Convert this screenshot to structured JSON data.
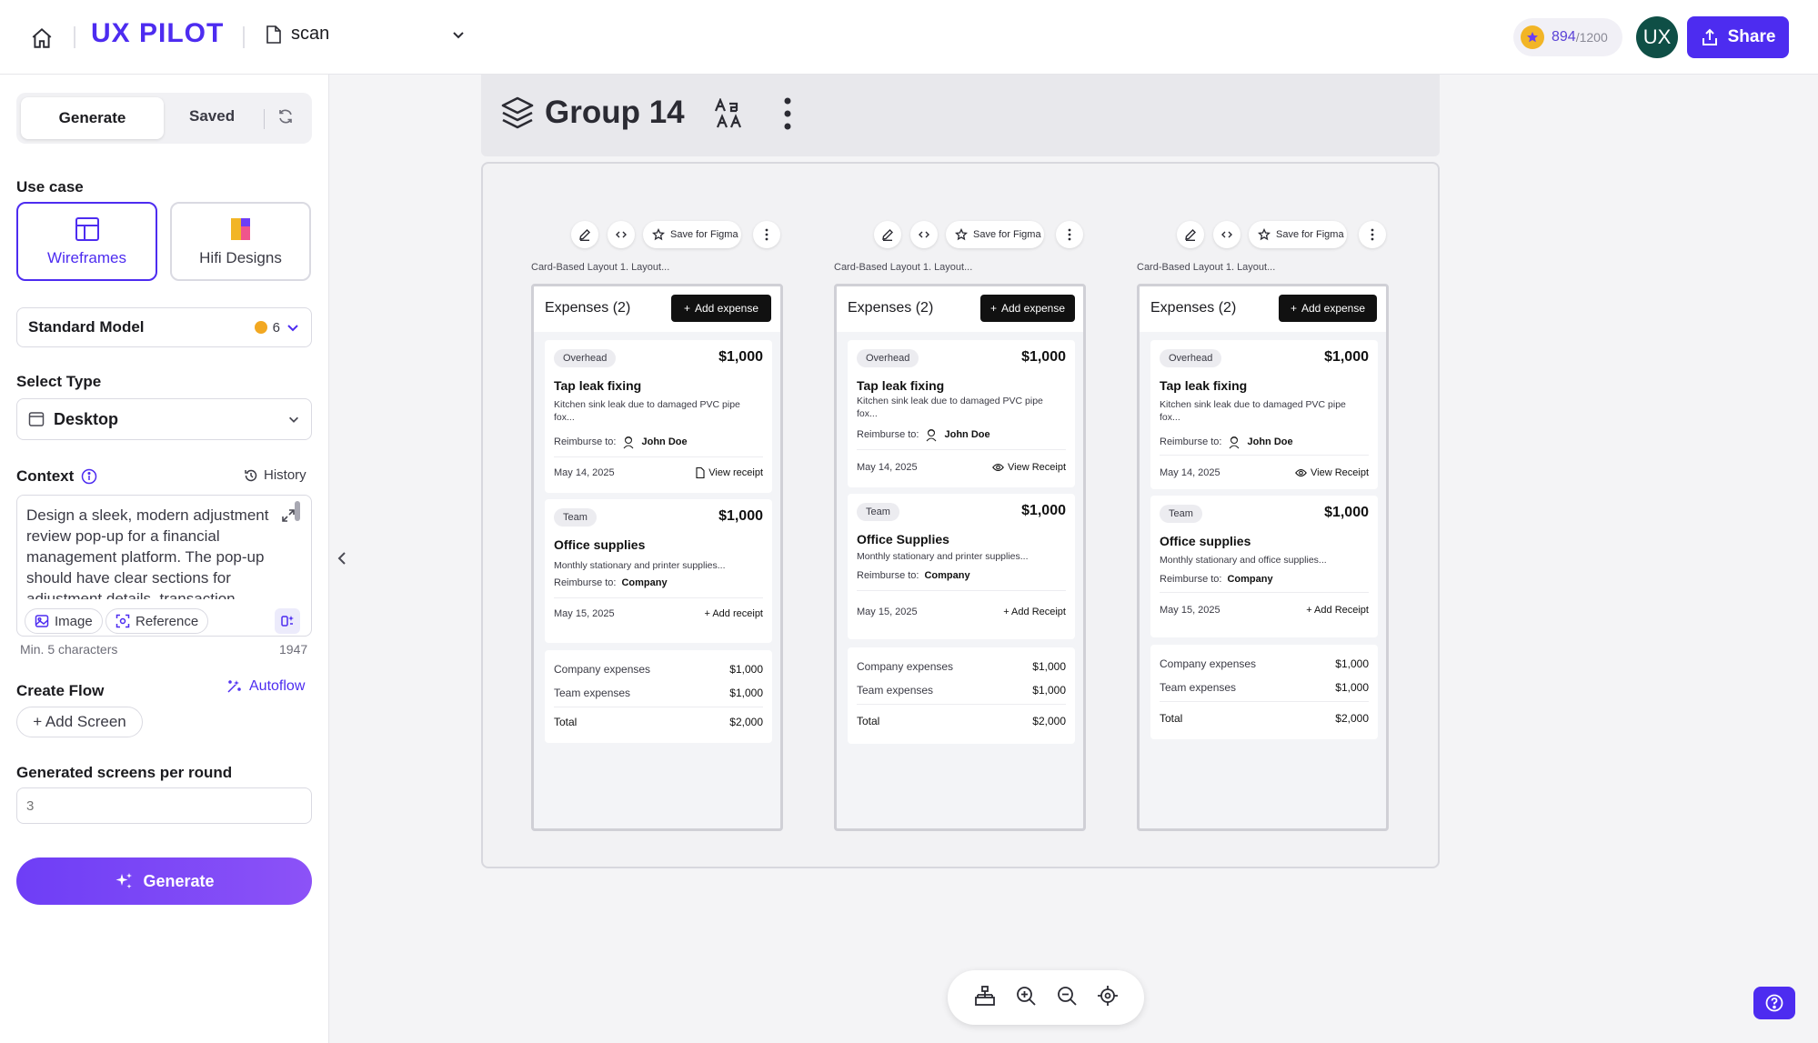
{
  "topbar": {
    "brand": "UX PILOT",
    "file_name": "scan",
    "credits_used": "894",
    "credits_max": "/1200",
    "avatar_initials": "UX",
    "share_label": "Share"
  },
  "sidebar": {
    "tabs": {
      "generate": "Generate",
      "saved": "Saved"
    },
    "use_case_label": "Use case",
    "use_cases": [
      {
        "label": "Wireframes",
        "active": true,
        "icon": "layout-icon"
      },
      {
        "label": "Hifi Designs",
        "active": false,
        "icon": "color-swatch-icon"
      }
    ],
    "model": {
      "name": "Standard Model",
      "cost": "6"
    },
    "select_type_label": "Select Type",
    "select_type_value": "Desktop",
    "context_label": "Context",
    "history_label": "History",
    "context_text": "Design a sleek, modern adjustment review pop-up for a financial management platform. The pop-up should have clear sections for adjustment details, transaction",
    "image_chip": "Image",
    "reference_chip": "Reference",
    "min_chars": "Min. 5 characters",
    "char_count": "1947",
    "create_flow_label": "Create Flow",
    "autoflow_label": "Autoflow",
    "add_screen_label": "+ Add Screen",
    "screens_per_round_label": "Generated screens per round",
    "screens_per_round_placeholder": "3",
    "generate_button": "Generate"
  },
  "canvas": {
    "group_title": "Group 14",
    "toolbar": {
      "save_for_figma": "Save for Figma"
    },
    "artboards": [
      {
        "caption": "Card-Based Layout 1. Layout...",
        "title": "Expenses (2)",
        "add_label": "Add expense",
        "cards": [
          {
            "tag": "Overhead",
            "amount": "$1,000",
            "title": "Tap leak fixing",
            "desc": "Kitchen sink leak due to damaged PVC pipe fox...",
            "reimburse_label": "Reimburse to:",
            "reimburse_to": "John Doe",
            "date": "May 14, 2025",
            "link": "View receipt"
          },
          {
            "tag": "Team",
            "amount": "$1,000",
            "title": "Office supplies",
            "desc": "Monthly stationary and printer supplies...",
            "reimburse_label": "Reimburse to:",
            "reimburse_to": "Company",
            "date": "May 15, 2025",
            "link": "+ Add receipt"
          }
        ],
        "summary": [
          {
            "label": "Company expenses",
            "value": "$1,000"
          },
          {
            "label": "Team expenses",
            "value": "$1,000"
          },
          {
            "label": "Total",
            "value": "$2,000"
          }
        ]
      },
      {
        "caption": "Card-Based Layout 1. Layout...",
        "title": "Expenses (2)",
        "add_label": "Add expense",
        "cards": [
          {
            "tag": "Overhead",
            "amount": "$1,000",
            "title": "Tap leak fixing",
            "desc": "Kitchen sink leak due to damaged PVC pipe fox...",
            "reimburse_label": "Reimburse to:",
            "reimburse_to": "John Doe",
            "date": "May 14, 2025",
            "link": "View Receipt"
          },
          {
            "tag": "Team",
            "amount": "$1,000",
            "title": "Office Supplies",
            "desc": "Monthly stationary and printer supplies...",
            "reimburse_label": "Reimburse to:",
            "reimburse_to": "Company",
            "date": "May 15, 2025",
            "link": "+ Add Receipt"
          }
        ],
        "summary": [
          {
            "label": "Company expenses",
            "value": "$1,000"
          },
          {
            "label": "Team expenses",
            "value": "$1,000"
          },
          {
            "label": "Total",
            "value": "$2,000"
          }
        ]
      },
      {
        "caption": "Card-Based Layout 1. Layout...",
        "title": "Expenses (2)",
        "add_label": "Add expense",
        "cards": [
          {
            "tag": "Overhead",
            "amount": "$1,000",
            "title": "Tap leak fixing",
            "desc": "Kitchen sink leak due to damaged PVC pipe fox...",
            "reimburse_label": "Reimburse to:",
            "reimburse_to": "John Doe",
            "date": "May 14, 2025",
            "link": "View Receipt"
          },
          {
            "tag": "Team",
            "amount": "$1,000",
            "title": "Office supplies",
            "desc": "Monthly stationary and office supplies...",
            "reimburse_label": "Reimburse to:",
            "reimburse_to": "Company",
            "date": "May 15, 2025",
            "link": "+ Add Receipt"
          }
        ],
        "summary": [
          {
            "label": "Company expenses",
            "value": "$1,000"
          },
          {
            "label": "Team expenses",
            "value": "$1,000"
          },
          {
            "label": "Total",
            "value": "$2,000"
          }
        ]
      }
    ]
  },
  "colors": {
    "accent": "#4d2cf0",
    "avatar_bg": "#0f4f46",
    "coin": "#f2b526"
  },
  "bottom_toolbar": {
    "icons": [
      "sitemap-icon",
      "zoom-in-icon",
      "zoom-out-icon",
      "target-icon"
    ]
  }
}
